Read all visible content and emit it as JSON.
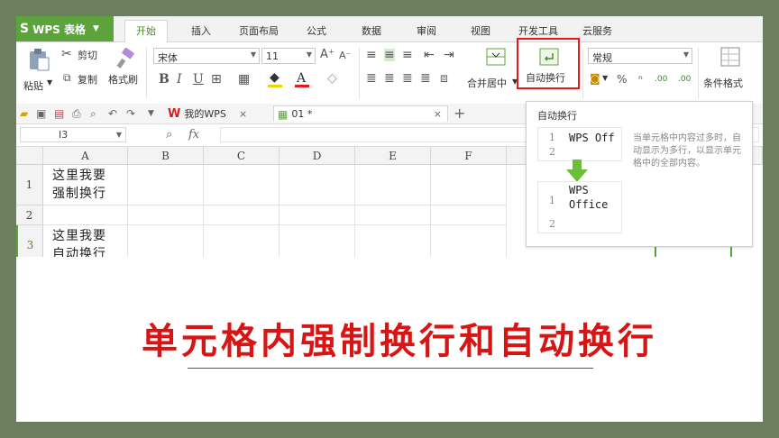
{
  "app": {
    "logo": "S",
    "name": "WPS 表格"
  },
  "menu": [
    "开始",
    "插入",
    "页面布局",
    "公式",
    "数据",
    "审阅",
    "视图",
    "开发工具",
    "云服务"
  ],
  "clipboard": {
    "paste": "粘贴",
    "cut": "剪切",
    "copy": "复制",
    "format_painter": "格式刷"
  },
  "font": {
    "name": "宋体",
    "size": "11",
    "bold": "B",
    "italic": "I",
    "underline": "U",
    "font_color_glyph": "A"
  },
  "alignment": {
    "merge_center": "合并居中",
    "wrap_text": "自动换行"
  },
  "number": {
    "format": "常规",
    "percent": "%",
    "comma": "ⁿ",
    "inc_decimal": ".00",
    "dec_decimal": ".00"
  },
  "styles": {
    "conditional_format": "条件格式"
  },
  "tabs": {
    "my_wps": "我的WPS",
    "file": "01 *"
  },
  "formula": {
    "cell_ref": "I3",
    "fx": "fx"
  },
  "columns": [
    "A",
    "B",
    "C",
    "D",
    "E",
    "F"
  ],
  "rows": [
    "1",
    "2",
    "3"
  ],
  "cells": {
    "a1_line1": "这里我要",
    "a1_line2": "强制换行",
    "a3_line1": "这里我要",
    "a3_line2": "自动换行"
  },
  "tooltip": {
    "title": "自动换行",
    "before_row1_num": "1",
    "before_row1_text": "WPS Off",
    "before_row2_num": "2",
    "after_row1_num": "1",
    "after_row1_line1": "WPS",
    "after_row1_line2": "Office",
    "after_row2_num": "2",
    "description": "当单元格中内容过多时，自动显示为多行，以显示单元格中的全部内容。"
  },
  "overlay_title": "单元格内强制换行和自动换行",
  "colors": {
    "wps_green": "#5da33c",
    "highlight_red": "#e11b1b",
    "title_red": "#d81515",
    "arrow_green": "#6bbf3a",
    "frame_bg": "#6b7f5f"
  }
}
